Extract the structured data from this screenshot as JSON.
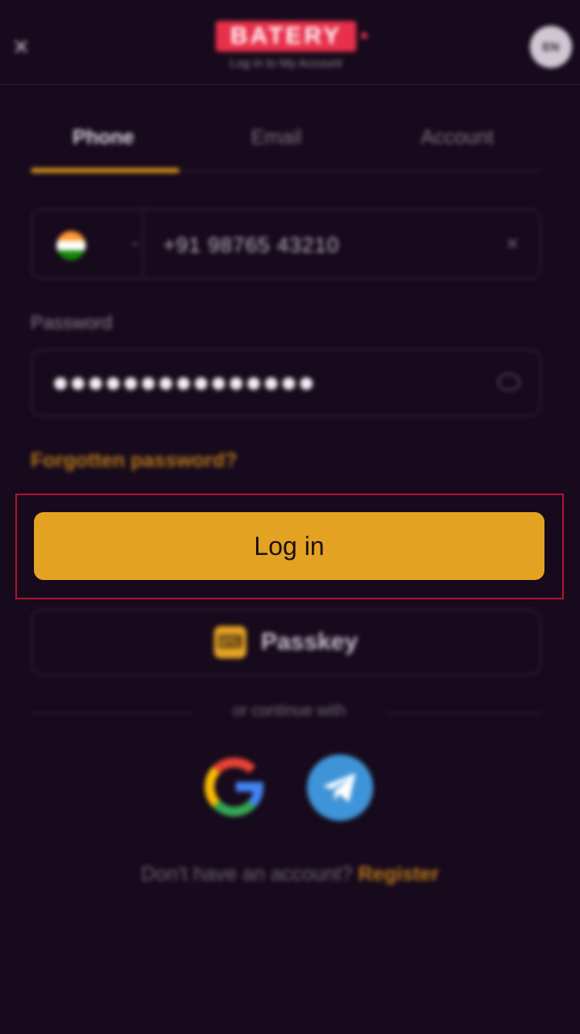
{
  "header": {
    "close_icon": "close-icon",
    "logo_text": "BATERY",
    "subtitle": "Log in to My Account",
    "language": "EN"
  },
  "tabs": [
    {
      "label": "Phone",
      "active": true
    },
    {
      "label": "Email",
      "active": false
    },
    {
      "label": "Account",
      "active": false
    }
  ],
  "phone": {
    "country": "India",
    "flag_colors": [
      "#ff9933",
      "#ffffff",
      "#138808"
    ],
    "value": "+91 98765 43210"
  },
  "password": {
    "label": "Password",
    "value": "●●●●●●●●●●●●●●●"
  },
  "forgot_label": "Forgotten password?",
  "login_label": "Log in",
  "passkey_label": "Passkey",
  "divider_text": "or continue with",
  "social": [
    "google-icon",
    "telegram-icon"
  ],
  "register": {
    "prompt": "Don't have an account?",
    "link": "Register"
  },
  "colors": {
    "background": "#170a1c",
    "accent": "#e3a222",
    "highlight_border": "#b1132f"
  }
}
